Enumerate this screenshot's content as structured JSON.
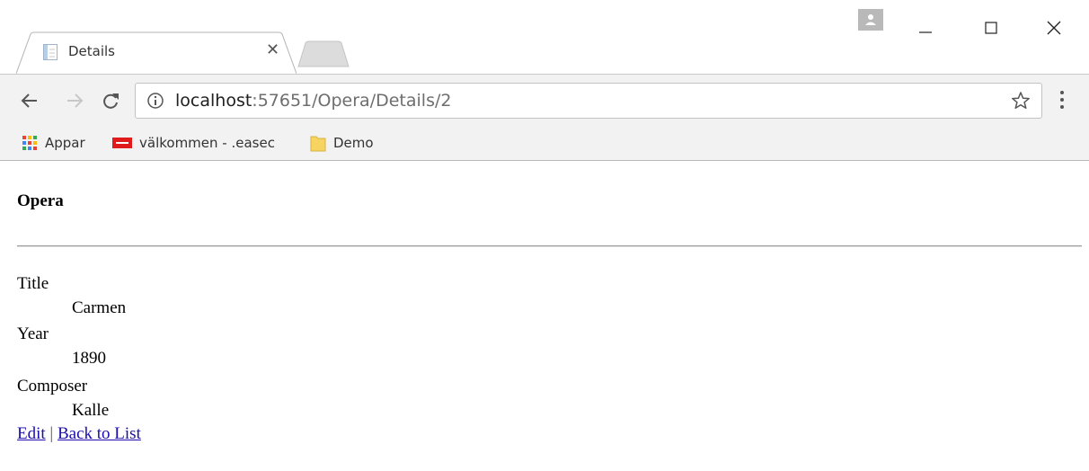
{
  "browser": {
    "tab": {
      "title": "Details"
    },
    "address": {
      "host": "localhost",
      "path": ":57651/Opera/Details/2"
    },
    "bookmarks": [
      {
        "label": "Appar",
        "icon": "apps-grid-icon"
      },
      {
        "label": "välkommen - .easec",
        "icon": "red-favicon-icon"
      },
      {
        "label": "Demo",
        "icon": "folder-icon"
      }
    ]
  },
  "page": {
    "heading": "Opera",
    "fields": [
      {
        "label": "Title",
        "value": "Carmen"
      },
      {
        "label": "Year",
        "value": "1890"
      },
      {
        "label": "Composer",
        "value": "Kalle"
      }
    ],
    "links": {
      "edit": "Edit",
      "separator": "|",
      "back": "Back to List"
    }
  },
  "colors": {
    "link": "#1a0dab",
    "toolbar": "#f2f2f2"
  }
}
